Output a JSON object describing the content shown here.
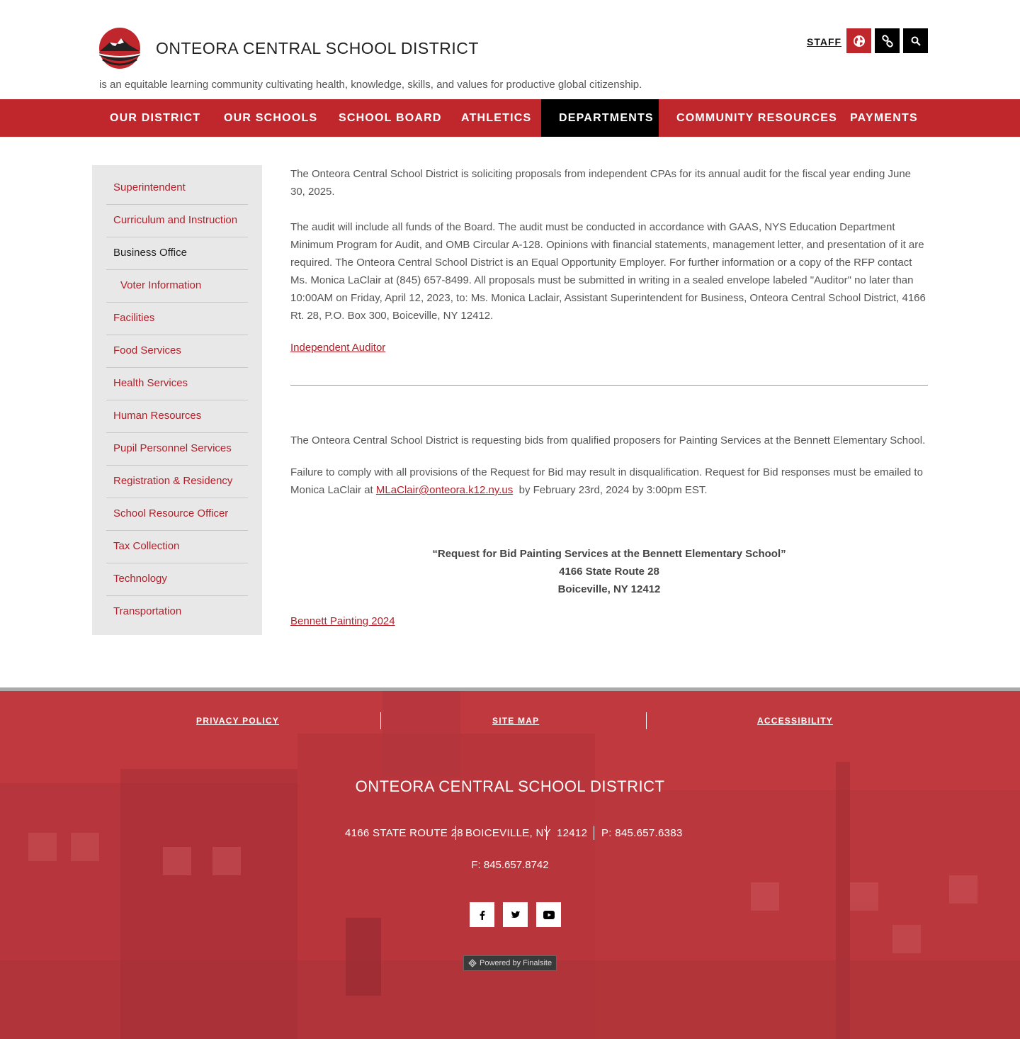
{
  "header": {
    "title": "ONTEORA CENTRAL SCHOOL DISTRICT",
    "tagline": "is an equitable learning community cultivating health, knowledge, skills, and values for productive global citizenship.",
    "staff_label": "STAFF",
    "icons": [
      "translate-icon",
      "links-icon",
      "search-icon"
    ]
  },
  "nav": {
    "items": [
      {
        "label": "OUR DISTRICT"
      },
      {
        "label": "OUR SCHOOLS"
      },
      {
        "label": "SCHOOL BOARD"
      },
      {
        "label": "ATHLETICS"
      },
      {
        "label": "DEPARTMENTS"
      },
      {
        "label": "COMMUNITY RESOURCES"
      },
      {
        "label": "PAYMENTS"
      }
    ],
    "active": "DEPARTMENTS"
  },
  "sidebar": {
    "items": [
      {
        "label": "Superintendent"
      },
      {
        "label": "Curriculum and Instruction"
      },
      {
        "label": "Business Office"
      },
      {
        "label": "Voter Information"
      },
      {
        "label": "Facilities"
      },
      {
        "label": "Food Services"
      },
      {
        "label": "Health Services"
      },
      {
        "label": "Human Resources"
      },
      {
        "label": "Pupil Personnel Services"
      },
      {
        "label": "Registration & Residency"
      },
      {
        "label": "School Resource Officer"
      },
      {
        "label": "Tax Collection"
      },
      {
        "label": "Technology"
      },
      {
        "label": "Transportation"
      }
    ],
    "current": "Business Office"
  },
  "main": {
    "audit_intro": "The Onteora Central School District is soliciting proposals from independent CPAs for its annual audit for the fiscal year ending June 30, 2025.",
    "audit_body": "The audit will include all funds of the Board. The audit must be conducted in accordance with GAAS, NYS Education Department Minimum Program for Audit, and OMB Circular A-128. Opinions with financial statements, management letter, and presentation of it are required. The Onteora Central School District is an Equal Opportunity Employer. For further information or a copy of the RFP contact Ms. Monica LaClair at (845) 657-8499. All proposals must be submitted in writing in a sealed envelope labeled \"Auditor\" no later than 10:00AM on Friday, April 12, 2023, to: Ms. Monica Laclair, Assistant Superintendent for Business, Onteora Central School District, 4166 Rt. 28, P.O. Box 300, Boiceville, NY 12412.",
    "audit_link": "Independent Auditor",
    "bid_intro": "The Onteora Central School District is requesting bids from qualified proposers for Painting Services at the Bennett Elementary School.",
    "bid_body_pre": "Failure to comply with all provisions of the Request for Bid may result in disqualification. Request for Bid responses must be emailed to Monica LaClair at ",
    "bid_email": "MLaClair@onteora.k12.ny.us",
    "bid_body_post": "  by February 23rd, 2024 by 3:00pm EST.",
    "bid_title": "“Request for Bid Painting Services at the Bennett Elementary School”",
    "bid_addr1": "4166 State Route 28",
    "bid_addr2": "Boiceville, NY 12412",
    "bid_link": "Bennett Painting 2024"
  },
  "footer": {
    "links": [
      "PRIVACY POLICY",
      "SITE MAP",
      "ACCESSIBILITY"
    ],
    "title": "ONTEORA CENTRAL SCHOOL DISTRICT",
    "address": "4166 STATE ROUTE 28",
    "city": "BOICEVILLE, NY",
    "zip": "12412",
    "phone": "P: 845.657.6383",
    "fax": "F: 845.657.8742",
    "social": [
      "facebook-icon",
      "twitter-icon",
      "youtube-icon"
    ],
    "powered": "Powered by Finalsite"
  },
  "colors": {
    "brand_red": "#c0272d",
    "nav_active": "#000000",
    "sidebar_bg": "#e8e8e8",
    "link": "#b3202a"
  }
}
